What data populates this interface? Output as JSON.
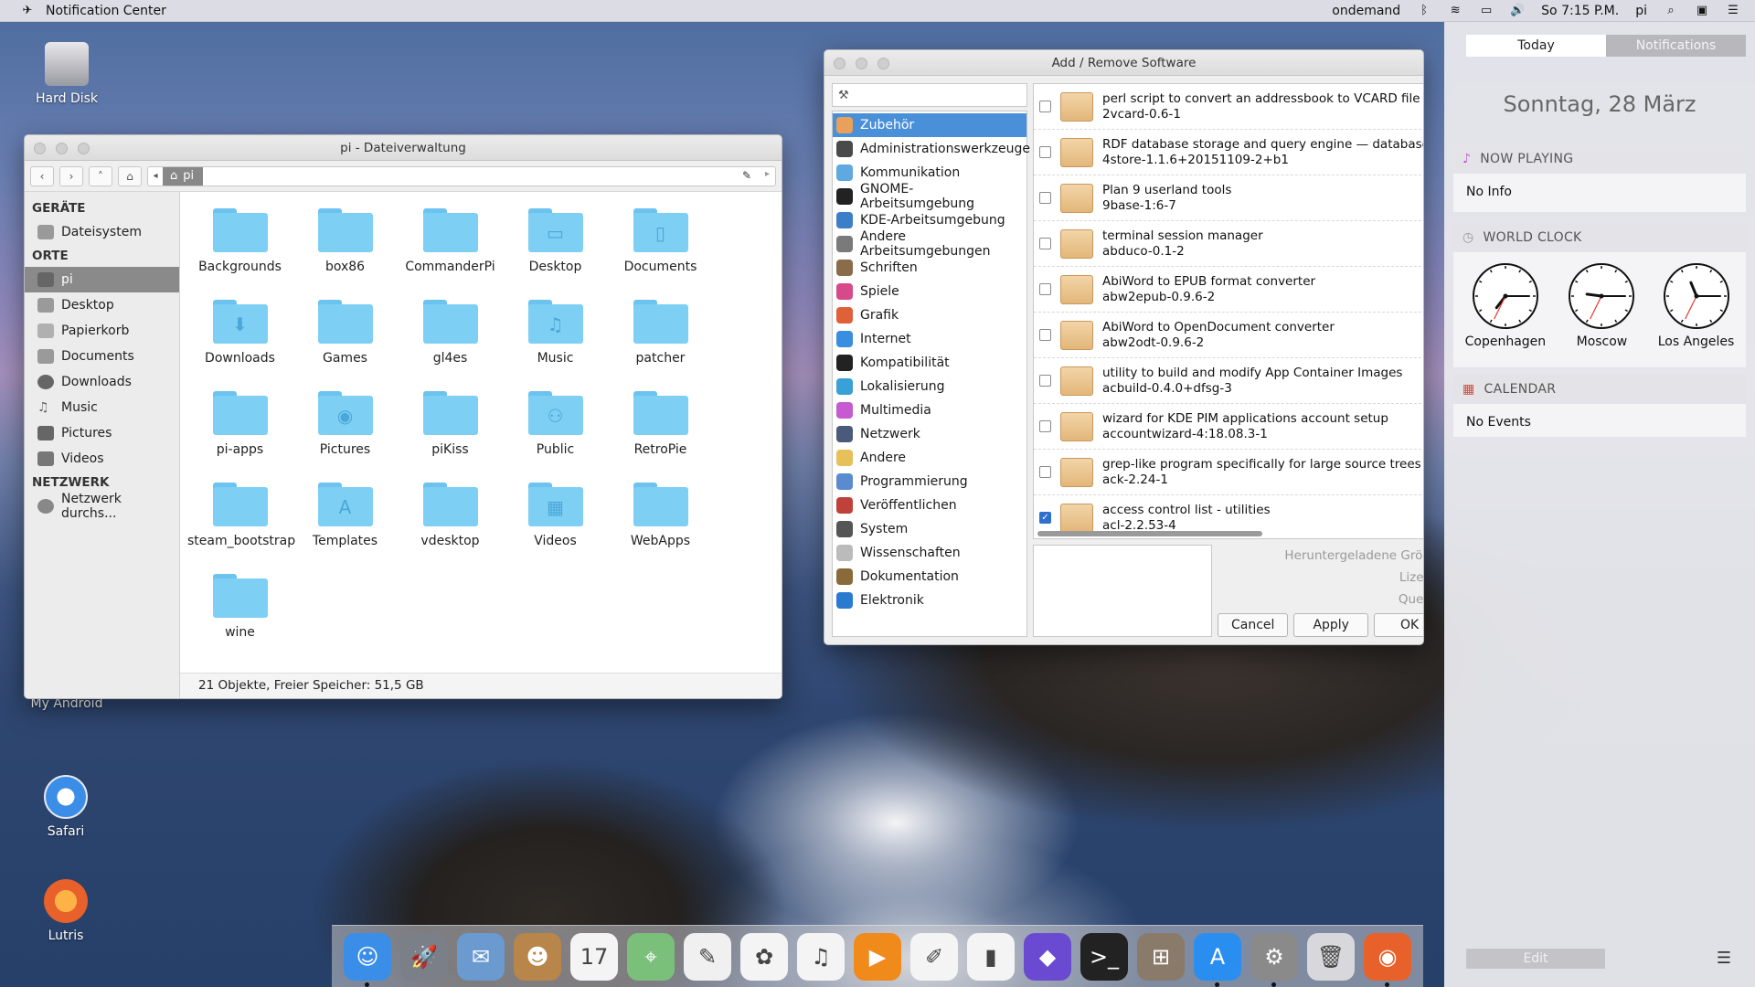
{
  "menubar": {
    "app_name": "Notification Center",
    "user_status": "ondemand",
    "clock": "So  7:15 P.M.",
    "user": "pi",
    "icons": [
      "bluetooth-icon",
      "wifi-icon",
      "battery-icon",
      "volume-icon",
      "search-icon",
      "window-icon",
      "list-icon"
    ]
  },
  "desktop": {
    "icons": [
      {
        "label": "Hard Disk"
      },
      {
        "label": "My Android"
      },
      {
        "label": "Safari"
      },
      {
        "label": "Lutris"
      }
    ]
  },
  "file_manager": {
    "title": "pi - Dateiverwaltung",
    "path": "pi",
    "sections": {
      "devices": "GERÄTE",
      "places": "ORTE",
      "network": "NETZWERK"
    },
    "devices": [
      {
        "label": "Dateisystem",
        "icon": "drive-icon"
      }
    ],
    "places": [
      {
        "label": "pi",
        "icon": "home-icon",
        "active": true
      },
      {
        "label": "Desktop",
        "icon": "desktop-icon"
      },
      {
        "label": "Papierkorb",
        "icon": "trash-icon"
      },
      {
        "label": "Documents",
        "icon": "document-icon"
      },
      {
        "label": "Downloads",
        "icon": "download-icon"
      },
      {
        "label": "Music",
        "icon": "music-icon"
      },
      {
        "label": "Pictures",
        "icon": "camera-icon"
      },
      {
        "label": "Videos",
        "icon": "film-icon"
      }
    ],
    "network": [
      {
        "label": "Netzwerk durchs...",
        "icon": "network-icon"
      }
    ],
    "files": [
      {
        "name": "Backgrounds",
        "glyph": ""
      },
      {
        "name": "box86",
        "glyph": ""
      },
      {
        "name": "CommanderPi",
        "glyph": ""
      },
      {
        "name": "Desktop",
        "glyph": "▭"
      },
      {
        "name": "Documents",
        "glyph": "▯"
      },
      {
        "name": "Downloads",
        "glyph": "⬇"
      },
      {
        "name": "Games",
        "glyph": ""
      },
      {
        "name": "gl4es",
        "glyph": ""
      },
      {
        "name": "Music",
        "glyph": "♫"
      },
      {
        "name": "patcher",
        "glyph": ""
      },
      {
        "name": "pi-apps",
        "glyph": ""
      },
      {
        "name": "Pictures",
        "glyph": "◉"
      },
      {
        "name": "piKiss",
        "glyph": ""
      },
      {
        "name": "Public",
        "glyph": "⚇"
      },
      {
        "name": "RetroPie",
        "glyph": ""
      },
      {
        "name": "steam_bootstrap",
        "glyph": ""
      },
      {
        "name": "Templates",
        "glyph": "A"
      },
      {
        "name": "vdesktop",
        "glyph": ""
      },
      {
        "name": "Videos",
        "glyph": "▦"
      },
      {
        "name": "WebApps",
        "glyph": ""
      },
      {
        "name": "wine",
        "glyph": ""
      }
    ],
    "status": "21 Objekte, Freier Speicher: 51,5 GB"
  },
  "software": {
    "title": "Add / Remove Software",
    "search_value": "",
    "categories": [
      {
        "label": "Zubehör",
        "color": "#e8a05a",
        "active": true
      },
      {
        "label": "Administrationswerkzeuge",
        "color": "#4a4a4a"
      },
      {
        "label": "Kommunikation",
        "color": "#5fa8e0"
      },
      {
        "label": "GNOME-Arbeitsumgebung",
        "color": "#222222"
      },
      {
        "label": "KDE-Arbeitsumgebung",
        "color": "#3d7ec8"
      },
      {
        "label": "Andere Arbeitsumgebungen",
        "color": "#7a7a7a"
      },
      {
        "label": "Schriften",
        "color": "#8a6b4a"
      },
      {
        "label": "Spiele",
        "color": "#d64a8a"
      },
      {
        "label": "Grafik",
        "color": "#e0603a"
      },
      {
        "label": "Internet",
        "color": "#3a8ee0"
      },
      {
        "label": "Kompatibilität",
        "color": "#222222"
      },
      {
        "label": "Lokalisierung",
        "color": "#3aa0d8"
      },
      {
        "label": "Multimedia",
        "color": "#c65ad0"
      },
      {
        "label": "Netzwerk",
        "color": "#4a5a7a"
      },
      {
        "label": "Andere",
        "color": "#e8c05a"
      },
      {
        "label": "Programmierung",
        "color": "#5a8ad0"
      },
      {
        "label": "Veröffentlichen",
        "color": "#c0403a"
      },
      {
        "label": "System",
        "color": "#555555"
      },
      {
        "label": "Wissenschaften",
        "color": "#bbbbbb"
      },
      {
        "label": "Dokumentation",
        "color": "#8a6a3a"
      },
      {
        "label": "Elektronik",
        "color": "#2a7ad0"
      }
    ],
    "packages": [
      {
        "desc": "perl script to convert an addressbook to VCARD file f",
        "name": "2vcard-0.6-1",
        "checked": false
      },
      {
        "desc": "RDF database storage and query engine — database",
        "name": "4store-1.1.6+20151109-2+b1",
        "checked": false
      },
      {
        "desc": "Plan 9 userland tools",
        "name": "9base-1:6-7",
        "checked": false
      },
      {
        "desc": "terminal session manager",
        "name": "abduco-0.1-2",
        "checked": false
      },
      {
        "desc": "AbiWord to EPUB format converter",
        "name": "abw2epub-0.9.6-2",
        "checked": false
      },
      {
        "desc": "AbiWord to OpenDocument converter",
        "name": "abw2odt-0.9.6-2",
        "checked": false
      },
      {
        "desc": "utility to build and modify App Container Images",
        "name": "acbuild-0.4.0+dfsg-3",
        "checked": false
      },
      {
        "desc": "wizard for KDE PIM applications account setup",
        "name": "accountwizard-4:18.08.3-1",
        "checked": false
      },
      {
        "desc": "grep-like program specifically for large source trees",
        "name": "ack-2.24-1",
        "checked": false
      },
      {
        "desc": "access control list - utilities",
        "name": "acl-2.2.53-4",
        "checked": true
      }
    ],
    "details": {
      "downloaded_size": "Heruntergeladene Größe",
      "license": "Lizenz",
      "source": "Quelle"
    },
    "buttons": {
      "cancel": "Cancel",
      "apply": "Apply",
      "ok": "OK"
    }
  },
  "notification_center": {
    "tabs": {
      "today": "Today",
      "notifications": "Notifications"
    },
    "date": "Sonntag, 28 März",
    "now_playing": {
      "title": "NOW PLAYING",
      "body": "No Info"
    },
    "world_clock": {
      "title": "WORLD CLOCK",
      "clocks": [
        {
          "city": "Copenhagen",
          "hour": 7,
          "minute": 15
        },
        {
          "city": "Moscow",
          "hour": 9,
          "minute": 15
        },
        {
          "city": "Los Angeles",
          "hour": 11,
          "minute": 15
        }
      ]
    },
    "calendar": {
      "title": "CALENDAR",
      "body": "No Events"
    },
    "edit_label": "Edit"
  },
  "dock": {
    "apps": [
      {
        "name": "finder-icon",
        "color": "#3a8ee8",
        "glyph": "☺",
        "running": true
      },
      {
        "name": "launchpad-icon",
        "color": "#7a7f88",
        "glyph": "🚀",
        "running": false
      },
      {
        "name": "mail-icon",
        "color": "#6a9ad0",
        "glyph": "✉",
        "running": false
      },
      {
        "name": "contacts-icon",
        "color": "#b8864a",
        "glyph": "☻",
        "running": false
      },
      {
        "name": "calendar-icon",
        "color": "#f4f4f4",
        "glyph": "17",
        "running": false
      },
      {
        "name": "maps-icon",
        "color": "#7ac07a",
        "glyph": "⌖",
        "running": false
      },
      {
        "name": "notes-icon",
        "color": "#f0f0f0",
        "glyph": "✎",
        "running": false
      },
      {
        "name": "photos-icon",
        "color": "#f4f4f4",
        "glyph": "✿",
        "running": false
      },
      {
        "name": "music-icon",
        "color": "#f4f4f4",
        "glyph": "♫",
        "running": false
      },
      {
        "name": "media-player-icon",
        "color": "#f08a1a",
        "glyph": "▶",
        "running": false
      },
      {
        "name": "text-editor-icon",
        "color": "#f4f4f4",
        "glyph": "✐",
        "running": false
      },
      {
        "name": "spreadsheet-icon",
        "color": "#f4f4f4",
        "glyph": "▮",
        "running": false
      },
      {
        "name": "screenshot-icon",
        "color": "#6a4ad0",
        "glyph": "◆",
        "running": false
      },
      {
        "name": "terminal-icon",
        "color": "#222222",
        "glyph": ">_",
        "running": false
      },
      {
        "name": "calculator-icon",
        "color": "#8a7a6a",
        "glyph": "⊞",
        "running": false
      },
      {
        "name": "app-store-icon",
        "color": "#2a8ef0",
        "glyph": "A",
        "running": true
      },
      {
        "name": "system-preferences-icon",
        "color": "#8a8a8a",
        "glyph": "⚙",
        "running": true
      },
      {
        "name": "trash-icon",
        "color": "#d8d8dc",
        "glyph": "🗑",
        "running": false
      },
      {
        "name": "firefox-icon",
        "color": "#e8602a",
        "glyph": "◉",
        "running": true
      }
    ]
  }
}
